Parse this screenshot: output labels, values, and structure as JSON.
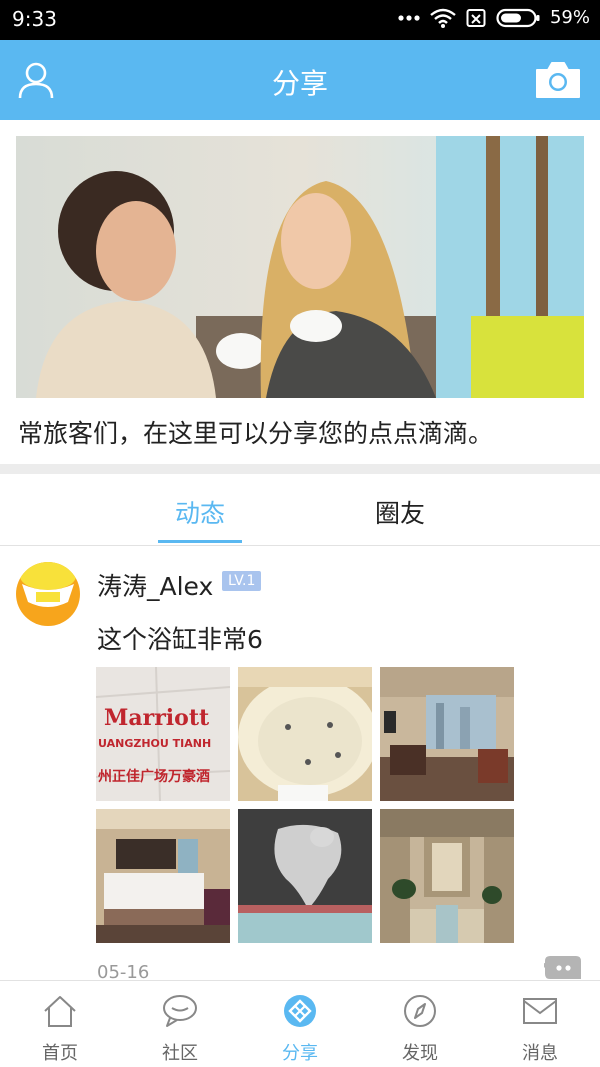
{
  "status_bar": {
    "time": "9:33",
    "battery": "59%",
    "icons": [
      "dots-icon",
      "wifi-icon",
      "no-sim-icon",
      "battery-icon"
    ]
  },
  "header": {
    "title": "分享",
    "left_icon": "user-icon",
    "right_icon": "camera-icon",
    "background": "#5ab8f1"
  },
  "banner": {
    "caption": "常旅客们，在这里可以分享您的点点滴滴。"
  },
  "tabs": [
    {
      "label": "动态",
      "active": true
    },
    {
      "label": "圈友",
      "active": false
    }
  ],
  "post": {
    "username": "涛涛_Alex",
    "level": "LV.1",
    "text": "这个浴缸非常6",
    "date": "05-16",
    "photos": [
      {
        "label_line1": "Marriott",
        "label_line2": "UANGZHOU TIANH",
        "label_line3": "州正佳广场万豪酒"
      },
      {
        "name": "bathtub"
      },
      {
        "name": "living-room"
      },
      {
        "name": "bedroom"
      },
      {
        "name": "pool-statue"
      },
      {
        "name": "lobby"
      }
    ]
  },
  "bottom_nav": [
    {
      "label": "首页",
      "icon": "home-icon",
      "active": false
    },
    {
      "label": "社区",
      "icon": "chat-bubble-icon",
      "active": false
    },
    {
      "label": "分享",
      "icon": "share-icon",
      "active": true
    },
    {
      "label": "发现",
      "icon": "compass-icon",
      "active": false
    },
    {
      "label": "消息",
      "icon": "mail-icon",
      "active": false
    }
  ],
  "colors": {
    "accent": "#5ab8f1",
    "badge": "#a9c4ee"
  }
}
